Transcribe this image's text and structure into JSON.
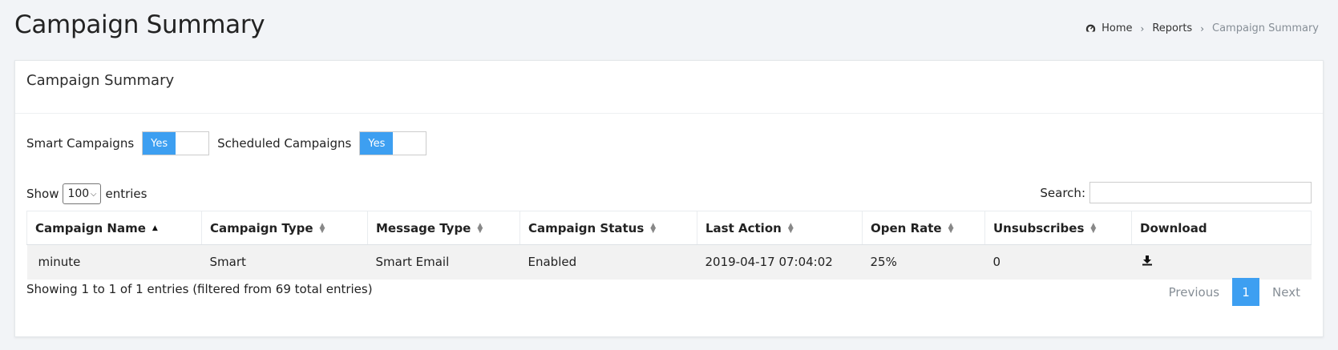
{
  "page_title": "Campaign Summary",
  "breadcrumb": {
    "home": "Home",
    "reports": "Reports",
    "current": "Campaign Summary"
  },
  "card": {
    "title": "Campaign Summary"
  },
  "toggles": {
    "smart_label": "Smart Campaigns",
    "smart_value": "Yes",
    "scheduled_label": "Scheduled Campaigns",
    "scheduled_value": "Yes"
  },
  "length": {
    "show": "Show",
    "value": "100",
    "entries": "entries"
  },
  "search": {
    "label": "Search:",
    "placeholder": ""
  },
  "table": {
    "headers": [
      "Campaign Name",
      "Campaign Type",
      "Message Type",
      "Campaign Status",
      "Last Action",
      "Open Rate",
      "Unsubscribes",
      "Download"
    ],
    "rows": [
      [
        "minute",
        "Smart",
        "Smart Email",
        "Enabled",
        "2019-04-17 07:04:02",
        "25%",
        "0"
      ]
    ]
  },
  "info": "Showing 1 to 1 of 1 entries (filtered from 69 total entries)",
  "pagination": {
    "previous": "Previous",
    "current": "1",
    "next": "Next"
  },
  "colors": {
    "accent": "#3d9ff1",
    "background": "#f2f4f7"
  }
}
